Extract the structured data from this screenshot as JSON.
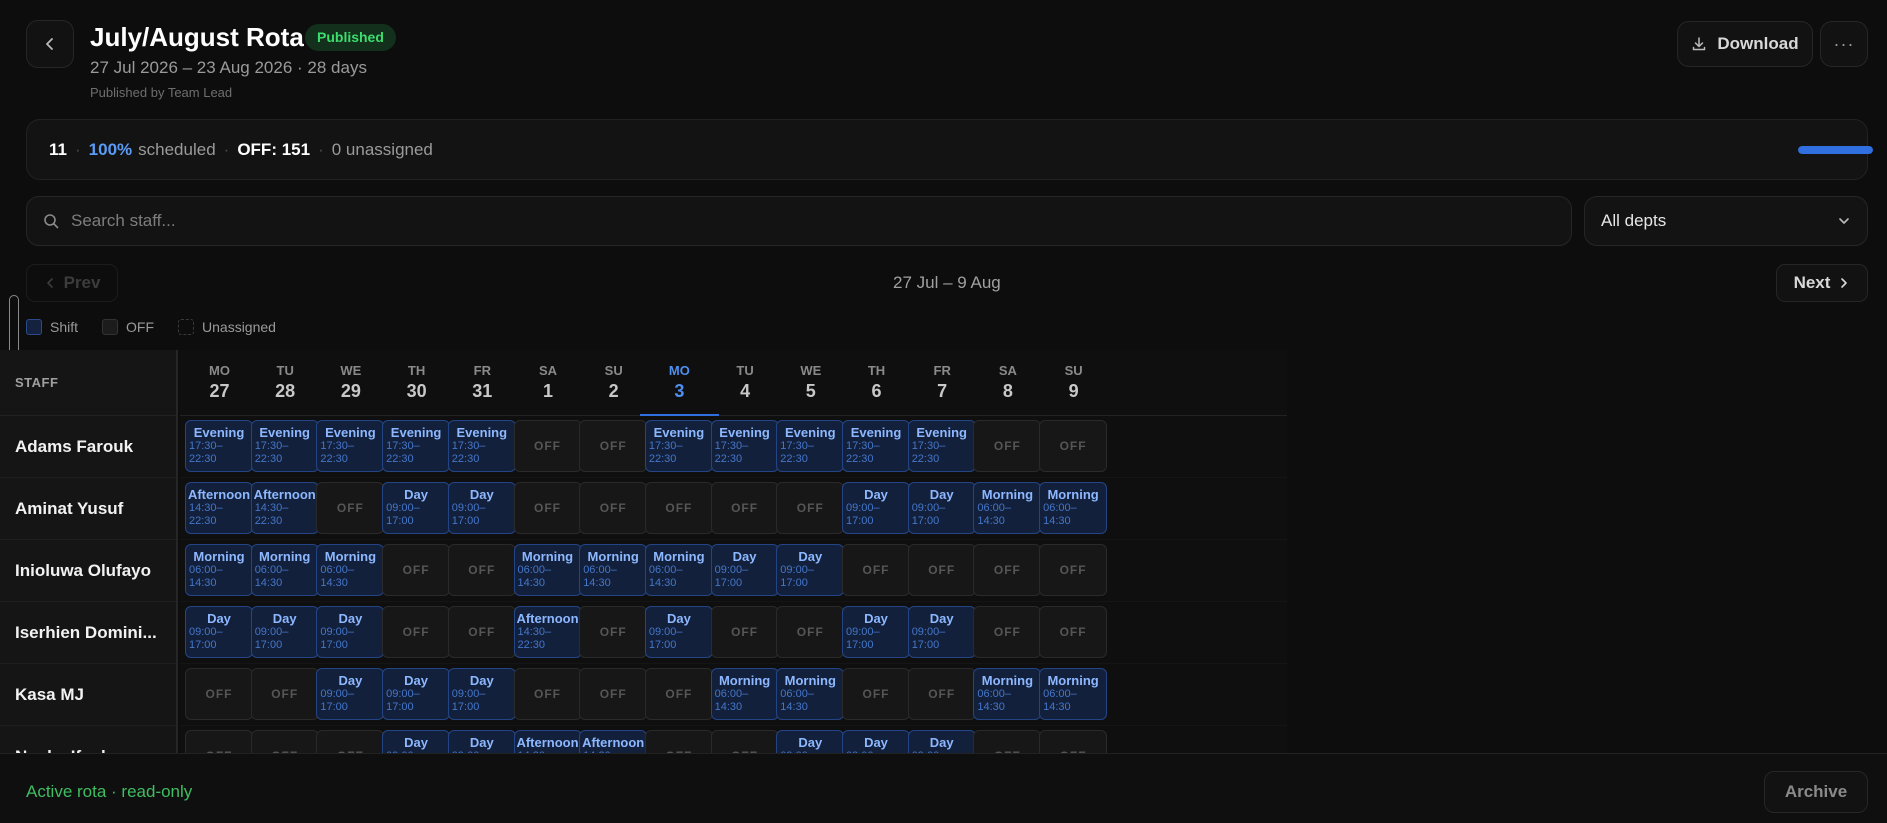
{
  "header": {
    "title": "July/August Rota",
    "badge": "Published",
    "subtitle": "27 Jul 2026 – 23 Aug 2026 · 28 days",
    "published_by": "Published by Team Lead",
    "download_label": "Download",
    "more_label": "···"
  },
  "stats": {
    "staff_count": "11",
    "scheduled_pct": "100%",
    "scheduled_label": "scheduled",
    "off_label": "OFF: 151",
    "unassigned_label": "0 unassigned",
    "progress_fraction": 1.0,
    "separator": "·"
  },
  "filters": {
    "search_placeholder": "Search staff...",
    "dept_selected": "All depts"
  },
  "nav": {
    "prev_label": "Prev",
    "range": "27 Jul – 9 Aug",
    "next_label": "Next"
  },
  "legend": {
    "shift": "Shift",
    "off": "OFF",
    "unassigned": "Unassigned"
  },
  "grid": {
    "staff_header": "STAFF",
    "days": [
      {
        "name": "MO",
        "date": "27"
      },
      {
        "name": "TU",
        "date": "28"
      },
      {
        "name": "WE",
        "date": "29"
      },
      {
        "name": "TH",
        "date": "30"
      },
      {
        "name": "FR",
        "date": "31"
      },
      {
        "name": "SA",
        "date": "1"
      },
      {
        "name": "SU",
        "date": "2"
      },
      {
        "name": "MO",
        "date": "3",
        "today": true
      },
      {
        "name": "TU",
        "date": "4"
      },
      {
        "name": "WE",
        "date": "5"
      },
      {
        "name": "TH",
        "date": "6"
      },
      {
        "name": "FR",
        "date": "7"
      },
      {
        "name": "SA",
        "date": "8"
      },
      {
        "name": "SU",
        "date": "9"
      }
    ],
    "shift_types": {
      "E": {
        "name": "Evening",
        "l1": "17:30–",
        "l2": "22:30"
      },
      "A": {
        "name": "Afternoon",
        "l1": "14:30–",
        "l2": "22:30"
      },
      "M": {
        "name": "Morning",
        "l1": "06:00–",
        "l2": "14:30"
      },
      "D": {
        "name": "Day",
        "l1": "09:00–",
        "l2": "17:00"
      }
    },
    "off_label": "OFF",
    "rows": [
      {
        "name": "Adams Farouk",
        "cells": [
          "E",
          "E",
          "E",
          "E",
          "E",
          "O",
          "O",
          "E",
          "E",
          "E",
          "E",
          "E",
          "O",
          "O"
        ]
      },
      {
        "name": "Aminat Yusuf",
        "cells": [
          "A",
          "A",
          "O",
          "D",
          "D",
          "O",
          "O",
          "O",
          "O",
          "O",
          "D",
          "D",
          "M",
          "M"
        ]
      },
      {
        "name": "Inioluwa Olufayo",
        "cells": [
          "M",
          "M",
          "M",
          "O",
          "O",
          "M",
          "M",
          "M",
          "D",
          "D",
          "O",
          "O",
          "O",
          "O"
        ]
      },
      {
        "name": "Iserhien Domini...",
        "cells": [
          "D",
          "D",
          "D",
          "O",
          "O",
          "A",
          "O",
          "D",
          "O",
          "O",
          "D",
          "D",
          "O",
          "O"
        ]
      },
      {
        "name": "Kasa MJ",
        "cells": [
          "O",
          "O",
          "D",
          "D",
          "D",
          "O",
          "O",
          "O",
          "M",
          "M",
          "O",
          "O",
          "M",
          "M"
        ]
      },
      {
        "name": "Nnaka Ifeoluwa",
        "cells": [
          "O",
          "O",
          "O",
          "D",
          "D",
          "A",
          "A",
          "O",
          "O",
          "D",
          "D",
          "D",
          "O",
          "O"
        ]
      }
    ]
  },
  "footer": {
    "status": "Active rota · read-only",
    "archive_label": "Archive"
  },
  "colors": {
    "accent": "#2f6fe0",
    "published": "#3ddc6e",
    "status_green": "#3fbd62"
  }
}
